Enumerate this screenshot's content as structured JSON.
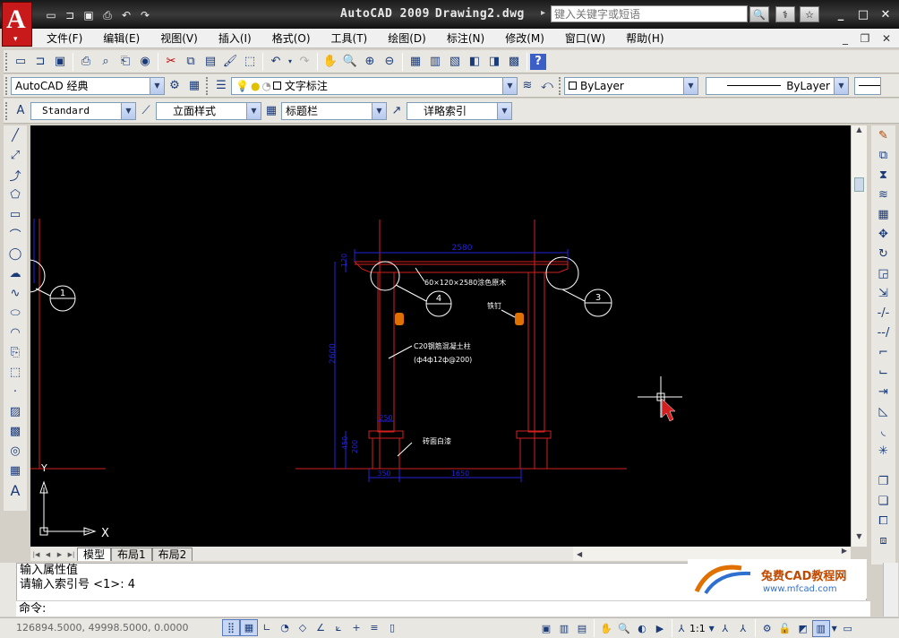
{
  "window": {
    "app_name": "AutoCAD 2009",
    "document": "Drawing2.dwg",
    "search_placeholder": "键入关键字或短语",
    "logo_letter": "A",
    "quick_access": [
      "new-icon",
      "open-icon",
      "save-icon",
      "plot-icon",
      "undo-icon",
      "redo-icon"
    ]
  },
  "menu": [
    "文件(F)",
    "编辑(E)",
    "视图(V)",
    "插入(I)",
    "格式(O)",
    "工具(T)",
    "绘图(D)",
    "标注(N)",
    "修改(M)",
    "窗口(W)",
    "帮助(H)"
  ],
  "toolbar_workspaces": {
    "workspace": "AutoCAD 经典",
    "layer": "文字标注",
    "color": "ByLayer",
    "linetype": "ByLayer"
  },
  "toolbar_styles": {
    "text_style": "Standard",
    "dim_style": "立面样式",
    "table_style": "标题栏",
    "multileader_style": "详略索引"
  },
  "drawing": {
    "dim_top": "2580",
    "dim_top_small": "120",
    "dim_height": "2600",
    "dim_base_1": "450",
    "dim_base_2": "200",
    "dim_bottom_1": "350",
    "dim_bottom_2": "1650",
    "dim_col": "250",
    "note_beam": "60×120×2580涂色原木",
    "note_column": "C20钢筋混凝土柱",
    "note_column_2": "(ф4ф12ф@200)",
    "note_base": "砖面白漆",
    "note_nail": "铁钉",
    "callout_1": "1",
    "callout_3": "3",
    "callout_4": "4",
    "ucs_x": "X",
    "ucs_y": "Y"
  },
  "tabs": [
    "模型",
    "布局1",
    "布局2"
  ],
  "command": {
    "line1": "输入属性值",
    "line2": "请输入索引号 <1>: 4",
    "prompt": "命令:",
    "watermark_title": "兔费CAD教程网",
    "watermark_url": "www.mfcad.com"
  },
  "status": {
    "coords": "126894.5000, 49998.5000, 0.0000",
    "scale": "1:1"
  },
  "colors": {
    "dim_blue": "#2323d8",
    "outline_red": "#d22020",
    "annotation_white": "#ffffff",
    "canvas": "#000000"
  }
}
